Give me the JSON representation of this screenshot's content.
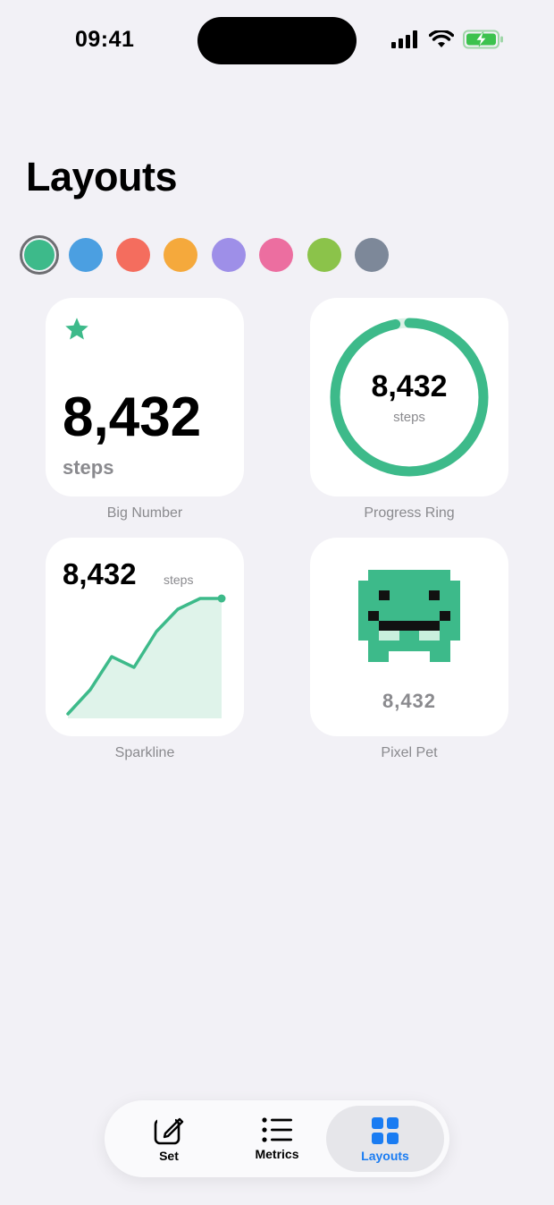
{
  "status_bar": {
    "time": "09:41"
  },
  "header": {
    "title": "Layouts"
  },
  "swatches": [
    {
      "color": "#3dba8a",
      "selected": true
    },
    {
      "color": "#4b9fe1"
    },
    {
      "color": "#f46d5e"
    },
    {
      "color": "#f5a93c"
    },
    {
      "color": "#9e8fe8"
    },
    {
      "color": "#ec6ea0"
    },
    {
      "color": "#8bc34a"
    },
    {
      "color": "#7d8899"
    }
  ],
  "accent_color": "#3dba8a",
  "cards": {
    "big_number": {
      "value": "8,432",
      "unit": "steps",
      "label": "Big Number",
      "icon": "star-icon"
    },
    "progress_ring": {
      "value": "8,432",
      "unit": "steps",
      "label": "Progress Ring",
      "progress": 0.97
    },
    "sparkline": {
      "value": "8,432",
      "unit": "steps",
      "label": "Sparkline"
    },
    "pixel_pet": {
      "value": "8,432",
      "label": "Pixel Pet"
    }
  },
  "tabs": [
    {
      "label": "Set",
      "icon": "compose-icon"
    },
    {
      "label": "Metrics",
      "icon": "list-icon"
    },
    {
      "label": "Layouts",
      "icon": "grid-icon",
      "active": true
    }
  ]
}
